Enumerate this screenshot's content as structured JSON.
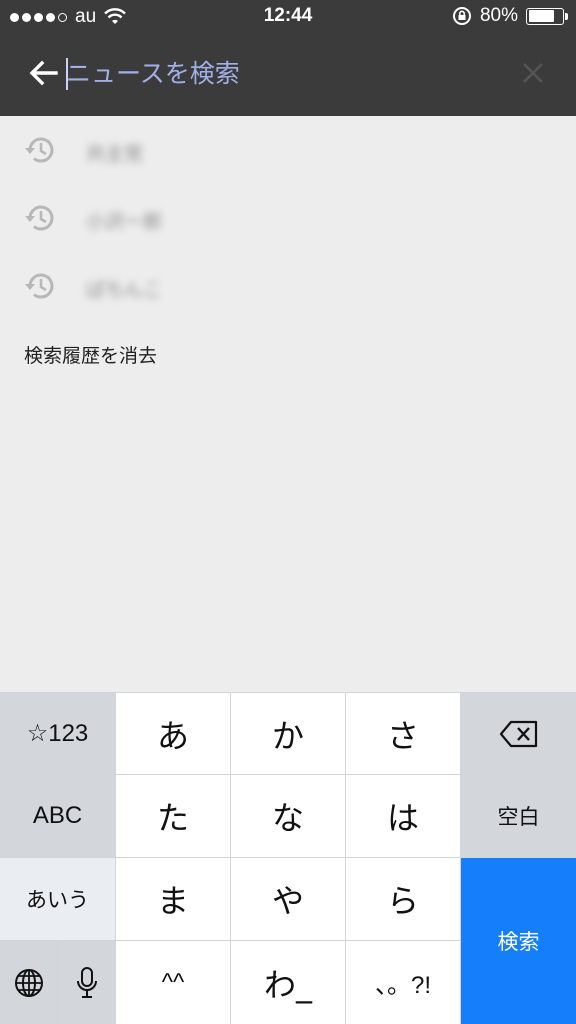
{
  "status_bar": {
    "carrier": "au",
    "time": "12:44",
    "battery": "80%",
    "battery_level": 0.8
  },
  "search": {
    "placeholder": "ニュースを検索"
  },
  "history": {
    "items": [
      "共主党",
      "小沢一郎",
      "ぱちんこ"
    ],
    "clear_label": "検索履歴を消去"
  },
  "keyboard": {
    "symbols_key": "☆123",
    "abc_key": "ABC",
    "kana_mode_key": "あいう",
    "kana_row1": [
      "あ",
      "か",
      "さ"
    ],
    "kana_row2": [
      "た",
      "な",
      "は"
    ],
    "kana_row3": [
      "ま",
      "や",
      "ら"
    ],
    "kana_row4": [
      "^^",
      "わ_",
      "、。?!"
    ],
    "space_key": "空白",
    "search_key": "検索",
    "globe_icon": "globe-icon",
    "mic_icon": "microphone-icon",
    "delete_icon": "delete-backward-icon",
    "accent_color": "#147efb"
  }
}
